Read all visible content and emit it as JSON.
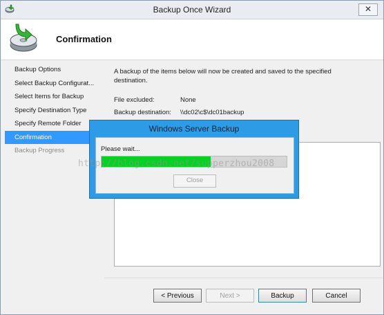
{
  "window": {
    "title": "Backup Once Wizard",
    "close_glyph": "✕",
    "app_icon": "windows-server-backup-icon"
  },
  "header": {
    "heading": "Confirmation",
    "icon": "backup-drive-icon"
  },
  "steps": [
    {
      "label": "Backup Options",
      "state": "normal"
    },
    {
      "label": "Select Backup Configurat...",
      "state": "normal"
    },
    {
      "label": "Select Items for Backup",
      "state": "normal"
    },
    {
      "label": "Specify Destination Type",
      "state": "normal"
    },
    {
      "label": "Specify Remote Folder",
      "state": "normal"
    },
    {
      "label": "Confirmation",
      "state": "active"
    },
    {
      "label": "Backup Progress",
      "state": "disabled"
    }
  ],
  "content": {
    "description": "A backup of the items below will now be created and saved to the specified destination.",
    "file_excluded_label": "File excluded:",
    "file_excluded_value": "None",
    "destination_label": "Backup destination:",
    "destination_value": "\\\\dc02\\c$\\dc01backup"
  },
  "buttons": {
    "previous": "< Previous",
    "next": "Next >",
    "backup": "Backup",
    "cancel": "Cancel"
  },
  "dialog": {
    "title": "Windows Server Backup",
    "status": "Please wait...",
    "progress_fraction": 0.59,
    "close_label": "Close"
  },
  "watermark": "http://blog.csdn.net/supperzhou2008",
  "colors": {
    "selection": "#3399ff",
    "dialog_frame": "#2e9be6",
    "progress_fill": "#06d025"
  }
}
